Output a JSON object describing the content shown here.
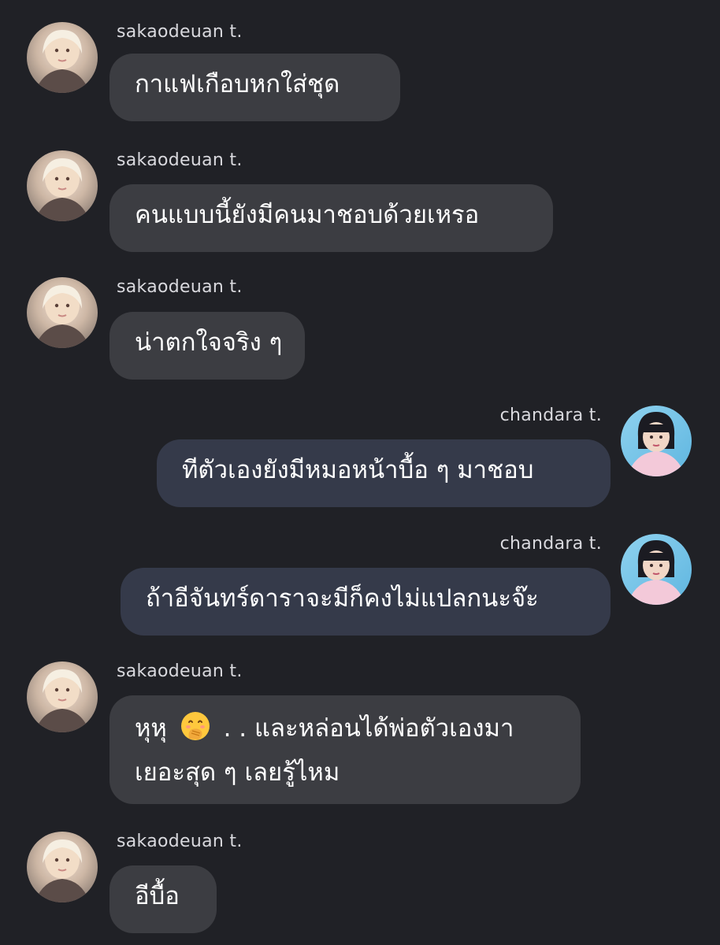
{
  "conversation": {
    "messages": [
      {
        "sender": "sakaodeuan t.",
        "side": "in",
        "text": "กาแฟเกือบหกใส่ชุด"
      },
      {
        "sender": "sakaodeuan t.",
        "side": "in",
        "text": "คนแบบนี้ยังมีคนมาชอบด้วยเหรอ"
      },
      {
        "sender": "sakaodeuan t.",
        "side": "in",
        "text": "น่าตกใจจริง ๆ"
      },
      {
        "sender": "chandara t.",
        "side": "out",
        "text": "ทีตัวเองยังมีหมอหน้าบื้อ ๆ มาชอบ"
      },
      {
        "sender": "chandara t.",
        "side": "out",
        "text": "ถ้าอีจันทร์ดาราจะมีก็คงไม่แปลกนะจ๊ะ"
      },
      {
        "sender": "sakaodeuan t.",
        "side": "in",
        "text_before_emoji": "หุหุ",
        "emoji": "face-with-hand-over-mouth-emoji",
        "text_after_emoji": ". . และหล่อนได้พ่อตัวเองมา",
        "text_line2": "เยอะสุด ๆ เลยรู้ไหม"
      },
      {
        "sender": "sakaodeuan t.",
        "side": "in",
        "text": "อีบื้อ"
      }
    ]
  },
  "colors": {
    "background": "#202126",
    "incoming_bubble": "#3c3d42",
    "outgoing_bubble": "#353a4a",
    "name_text": "#d9d9de"
  }
}
